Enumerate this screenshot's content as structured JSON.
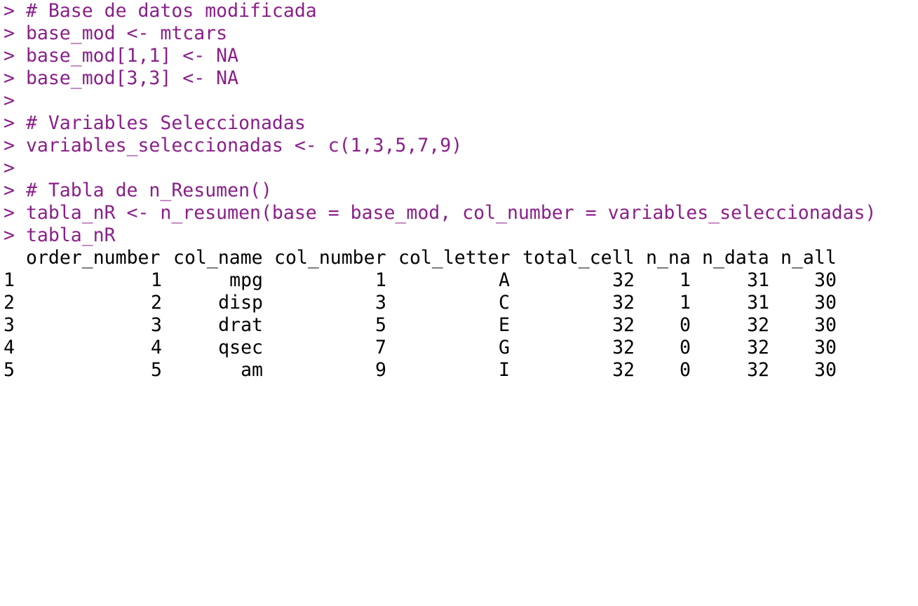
{
  "console": {
    "prompt": ">",
    "input_lines": [
      "# Base de datos modificada",
      "base_mod <- mtcars",
      "base_mod[1,1] <- NA",
      "base_mod[3,3] <- NA",
      "",
      "# Variables Seleccionadas",
      "variables_seleccionadas <- c(1,3,5,7,9)",
      "",
      "# Tabla de n_Resumen()",
      "tabla_nR <- n_resumen(base = base_mod, col_number = variables_seleccionadas)",
      "tabla_nR"
    ]
  },
  "output_table": {
    "headers": [
      "order_number",
      "col_name",
      "col_number",
      "col_letter",
      "total_cell",
      "n_na",
      "n_data",
      "n_all"
    ],
    "rows": [
      {
        "rowname": "1",
        "order_number": "1",
        "col_name": "mpg",
        "col_number": "1",
        "col_letter": "A",
        "total_cell": "32",
        "n_na": "1",
        "n_data": "31",
        "n_all": "30"
      },
      {
        "rowname": "2",
        "order_number": "2",
        "col_name": "disp",
        "col_number": "3",
        "col_letter": "C",
        "total_cell": "32",
        "n_na": "1",
        "n_data": "31",
        "n_all": "30"
      },
      {
        "rowname": "3",
        "order_number": "3",
        "col_name": "drat",
        "col_number": "5",
        "col_letter": "E",
        "total_cell": "32",
        "n_na": "0",
        "n_data": "32",
        "n_all": "30"
      },
      {
        "rowname": "4",
        "order_number": "4",
        "col_name": "qsec",
        "col_number": "7",
        "col_letter": "G",
        "total_cell": "32",
        "n_na": "0",
        "n_data": "32",
        "n_all": "30"
      },
      {
        "rowname": "5",
        "order_number": "5",
        "col_name": "am",
        "col_number": "9",
        "col_letter": "I",
        "total_cell": "32",
        "n_na": "0",
        "n_data": "32",
        "n_all": "30"
      }
    ]
  },
  "colors": {
    "command": "#8a1f8a",
    "output": "#000000",
    "background": "#ffffff"
  }
}
